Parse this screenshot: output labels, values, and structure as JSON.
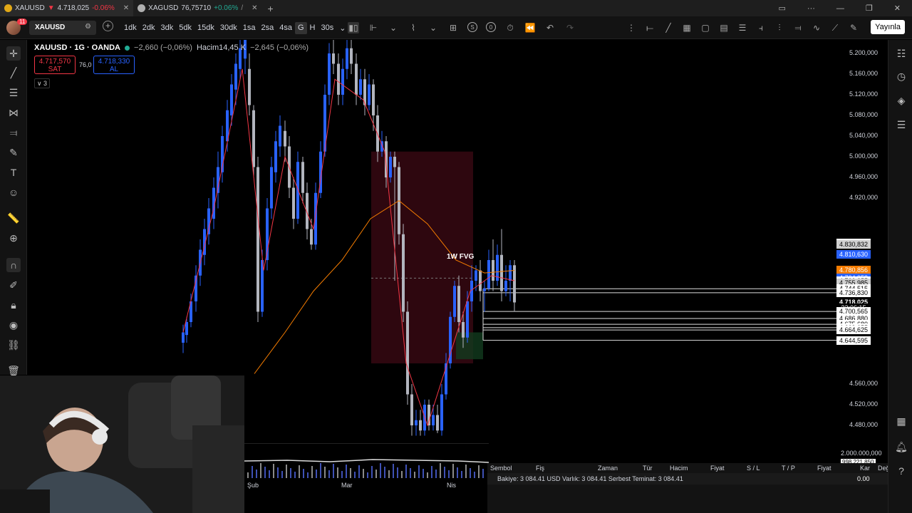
{
  "tabs": [
    {
      "symbol": "XAUUSD",
      "arrow": "▼",
      "price": "4.718,025",
      "change": "-0.06%",
      "dir": "down",
      "close": "✕",
      "coin_color": "#e2a917"
    },
    {
      "symbol": "XAGUSD",
      "arrow": "",
      "price": "76,75710",
      "change": "+0.06%",
      "extra": "/",
      "dir": "up",
      "close": "✕",
      "coin_color": "#b0b0b0"
    }
  ],
  "new_tab": "+",
  "window_controls": [
    "▭",
    "···",
    "—",
    "❐",
    "✕"
  ],
  "toolbar": {
    "notif_count": "11",
    "symbol": "XAUUSD",
    "intervals": [
      "1dk",
      "2dk",
      "3dk",
      "5dk",
      "15dk",
      "30dk",
      "1sa",
      "2sa",
      "4sa",
      "G",
      "H",
      "30s"
    ],
    "selected_interval": "G",
    "circle_s": "S",
    "circle_o": "0",
    "publish": "Yayınla"
  },
  "legend": {
    "title": "XAUUSD · 1G · OANDA",
    "change": "−2,660 (−0,06%)",
    "volume_label": "Hacim",
    "volume": "14,45 K",
    "vol_change": "−2,645 (−0,06%)",
    "sell_price": "4.717,570",
    "sell_label": "SAT",
    "spread": "76,0",
    "buy_price": "4.718,330",
    "buy_label": "AL",
    "collapse": "∨ 3"
  },
  "fvg_label": "1W FVG",
  "y_ticks": [
    {
      "label": "5.200,000",
      "value": 5200
    },
    {
      "label": "5.160,000",
      "value": 5160
    },
    {
      "label": "5.120,000",
      "value": 5120
    },
    {
      "label": "5.080,000",
      "value": 5080
    },
    {
      "label": "5.040,000",
      "value": 5040
    },
    {
      "label": "5.000,000",
      "value": 5000
    },
    {
      "label": "4.960,000",
      "value": 4960
    },
    {
      "label": "4.920,000",
      "value": 4920
    },
    {
      "label": "4.560,000",
      "value": 4560
    },
    {
      "label": "4.520,000",
      "value": 4520
    },
    {
      "label": "4.480,000",
      "value": 4480
    }
  ],
  "price_tags": [
    {
      "label": "4.833,025",
      "value": 4833.025,
      "style": "white"
    },
    {
      "label": "4.830,832",
      "value": 4830.832,
      "style": "gray"
    },
    {
      "label": "4.810,630",
      "value": 4810.63,
      "style": "blue"
    },
    {
      "label": "4.780,856",
      "value": 4780.856,
      "style": "orange"
    },
    {
      "label": "4.764,953",
      "value": 4764.953,
      "style": "blue"
    },
    {
      "label": "4.760,355",
      "value": 4760.355,
      "style": "white"
    },
    {
      "label": "4.755,985",
      "value": 4755.985,
      "style": "gray"
    },
    {
      "label": "4.745,375",
      "value": 4745.375,
      "style": "blue"
    },
    {
      "label": "4.744,515",
      "value": 4744.515,
      "style": "white"
    },
    {
      "label": "4.736,830",
      "value": 4736.83,
      "style": "white"
    },
    {
      "label": "4.718,025",
      "value": 4718.025,
      "style": "cur"
    },
    {
      "label": "22:06:15",
      "value": 4708,
      "style": "cnt"
    },
    {
      "label": "4.700,565",
      "value": 4700.565,
      "style": "white"
    },
    {
      "label": "4.686,880",
      "value": 4686.88,
      "style": "white"
    },
    {
      "label": "4.675,680",
      "value": 4675.68,
      "style": "white"
    },
    {
      "label": "4.669,055",
      "value": 4669.055,
      "style": "white"
    },
    {
      "label": "4.664,625",
      "value": 4664.625,
      "style": "white"
    },
    {
      "label": "4.644,595",
      "value": 4644.595,
      "style": "white"
    }
  ],
  "volume_axis": [
    "2.000.000,000",
    "998.221,850"
  ],
  "time_labels": [
    "Şub",
    "Mar",
    "Nis"
  ],
  "panel": {
    "headers": [
      "Sembol",
      "Fiş",
      "Zaman",
      "Tür",
      "Hacim",
      "Fiyat",
      "S / L",
      "T / P",
      "Fiyat",
      "Kar",
      "Değişim"
    ],
    "balance": "Bakiye: 3 084.41 USD  Varlık: 3 084.41  Serbest Teminat: 3 084.41",
    "pnl": "0.00"
  },
  "colors": {
    "up": "#2962ff",
    "down": "#b2b5be",
    "ma_fast": "#f23645",
    "ma_slow": "#f57c00",
    "fvg": "#3d0a14",
    "bg": "#000000"
  },
  "left_tools": [
    "crosshair-icon",
    "trend-line-icon",
    "fib-icon",
    "pattern-icon",
    "projection-icon",
    "brush-icon",
    "text-icon",
    "emoji-icon",
    "ruler-icon",
    "zoom-icon",
    "magnet-icon",
    "lock-draw-icon",
    "lock-icon",
    "eye-icon",
    "link-icon",
    "trash-icon"
  ],
  "right_tools": [
    "watchlist-icon",
    "alerts-icon",
    "layers-icon",
    "chat-icon",
    "calendar-icon",
    "notifications-icon",
    "help-icon"
  ]
}
